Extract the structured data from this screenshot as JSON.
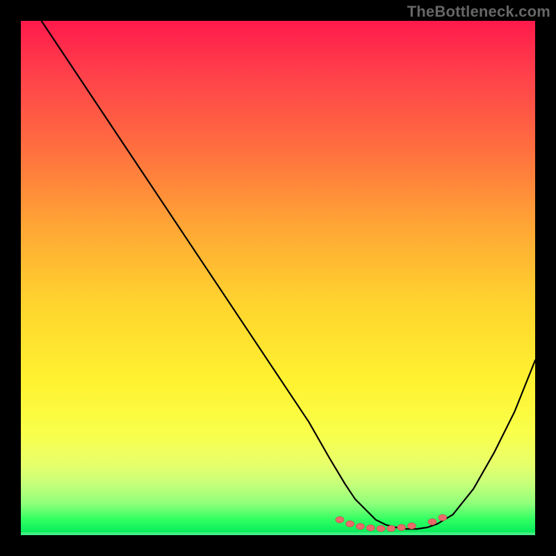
{
  "watermark": "TheBottleneck.com",
  "colors": {
    "background": "#000000",
    "line": "#000000",
    "marker_fill": "#e86a6a",
    "marker_stroke": "#c24a4a",
    "gradient_top": "#ff1a4b",
    "gradient_bottom": "#00e85c"
  },
  "chart_data": {
    "type": "line",
    "title": "",
    "xlabel": "",
    "ylabel": "",
    "xlim": [
      0,
      100
    ],
    "ylim": [
      0,
      100
    ],
    "grid": false,
    "x": [
      4,
      8,
      14,
      20,
      26,
      32,
      38,
      44,
      50,
      56,
      60,
      63,
      65,
      67,
      69,
      71,
      73,
      75,
      77,
      79,
      81,
      84,
      88,
      92,
      96,
      100
    ],
    "values": [
      100,
      94,
      85,
      76,
      67,
      58,
      49,
      40,
      31,
      22,
      15,
      10,
      7,
      5,
      3,
      2,
      1.5,
      1.2,
      1.2,
      1.5,
      2.2,
      4,
      9,
      16,
      24,
      34
    ],
    "markers": [
      {
        "x": 62,
        "y": 3.0
      },
      {
        "x": 64,
        "y": 2.2
      },
      {
        "x": 66,
        "y": 1.7
      },
      {
        "x": 68,
        "y": 1.4
      },
      {
        "x": 70,
        "y": 1.3
      },
      {
        "x": 72,
        "y": 1.3
      },
      {
        "x": 74,
        "y": 1.5
      },
      {
        "x": 76,
        "y": 1.8
      },
      {
        "x": 80,
        "y": 2.6
      },
      {
        "x": 82,
        "y": 3.4
      }
    ]
  }
}
